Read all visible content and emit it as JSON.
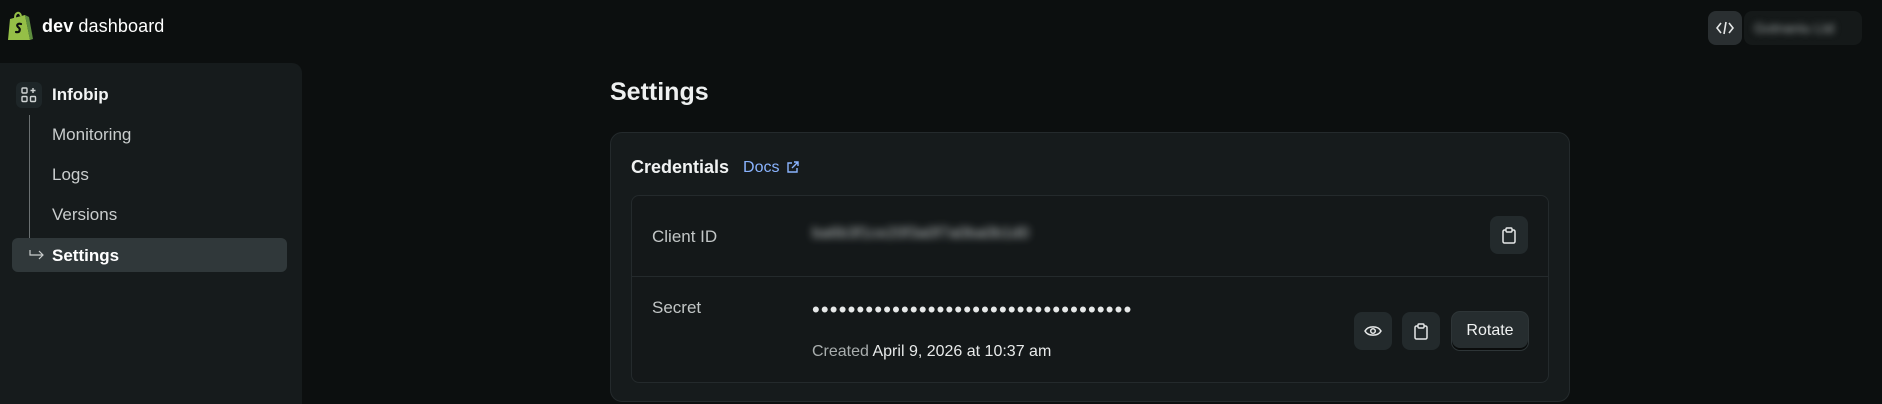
{
  "header": {
    "brand_bold": "dev",
    "brand_rest": " dashboard",
    "account_name": "Gotnaniu Ltd",
    "dev_tools_icon": "code-icon"
  },
  "sidebar": {
    "app_name": "Infobip",
    "items": [
      {
        "label": "Monitoring",
        "active": false
      },
      {
        "label": "Logs",
        "active": false
      },
      {
        "label": "Versions",
        "active": false
      },
      {
        "label": "Settings",
        "active": true
      }
    ]
  },
  "main": {
    "title": "Settings",
    "credentials": {
      "title": "Credentials",
      "docs_label": "Docs",
      "client_id_label": "Client ID",
      "client_id_value": "ba6b3f1ce20f3a0f7a0ba0b1d0",
      "secret_label": "Secret",
      "secret_masked": "••••••••••••••••••••••••••••••••••••",
      "created_prefix": "Created",
      "created_date": "April 9, 2026 at 10:37 am",
      "rotate_label": "Rotate"
    }
  },
  "colors": {
    "background": "#0c0f0f",
    "surface": "#161b1c",
    "active_nav": "#30383a",
    "link": "#8ab4ff",
    "brand_green": "#95bf47"
  }
}
